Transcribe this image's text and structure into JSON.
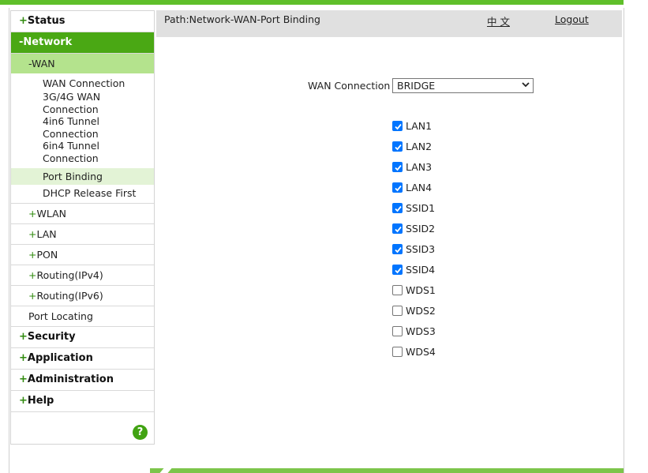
{
  "sidebar": {
    "status": "Status",
    "network": "Network",
    "wan": "WAN",
    "wan_items": [
      "WAN Connection",
      "3G/4G WAN",
      "Connection",
      "4in6 Tunnel",
      "Connection",
      "6in4 Tunnel",
      "Connection",
      "Port Binding",
      "DHCP Release First"
    ],
    "wlan": "WLAN",
    "lan": "LAN",
    "pon": "PON",
    "routing_ipv4": "Routing(IPv4)",
    "routing_ipv6": "Routing(IPv6)",
    "port_locating": "Port Locating",
    "security": "Security",
    "application": "Application",
    "administration": "Administration",
    "help": "Help",
    "plus": "+",
    "minus": "-",
    "help_icon_glyph": "?"
  },
  "header": {
    "path": "Path:Network-WAN-Port Binding",
    "language": "中 文",
    "logout": "Logout"
  },
  "form": {
    "wan_connection_label": "WAN Connection",
    "wan_connection_value": "BRIDGE",
    "ports": [
      {
        "label": "LAN1",
        "checked": true
      },
      {
        "label": "LAN2",
        "checked": true
      },
      {
        "label": "LAN3",
        "checked": true
      },
      {
        "label": "LAN4",
        "checked": true
      },
      {
        "label": "SSID1",
        "checked": true
      },
      {
        "label": "SSID2",
        "checked": true
      },
      {
        "label": "SSID3",
        "checked": true
      },
      {
        "label": "SSID4",
        "checked": true
      },
      {
        "label": "WDS1",
        "checked": false
      },
      {
        "label": "WDS2",
        "checked": false
      },
      {
        "label": "WDS3",
        "checked": false
      },
      {
        "label": "WDS4",
        "checked": false
      }
    ]
  },
  "colors": {
    "accent_green": "#4aa814",
    "submenu_green": "#b4e38d",
    "checkbox_blue": "#0075ff"
  },
  "icons": {
    "help": "question-mark-icon",
    "select_chevron": "chevron-down-icon",
    "checkbox_check": "checkmark-icon"
  }
}
